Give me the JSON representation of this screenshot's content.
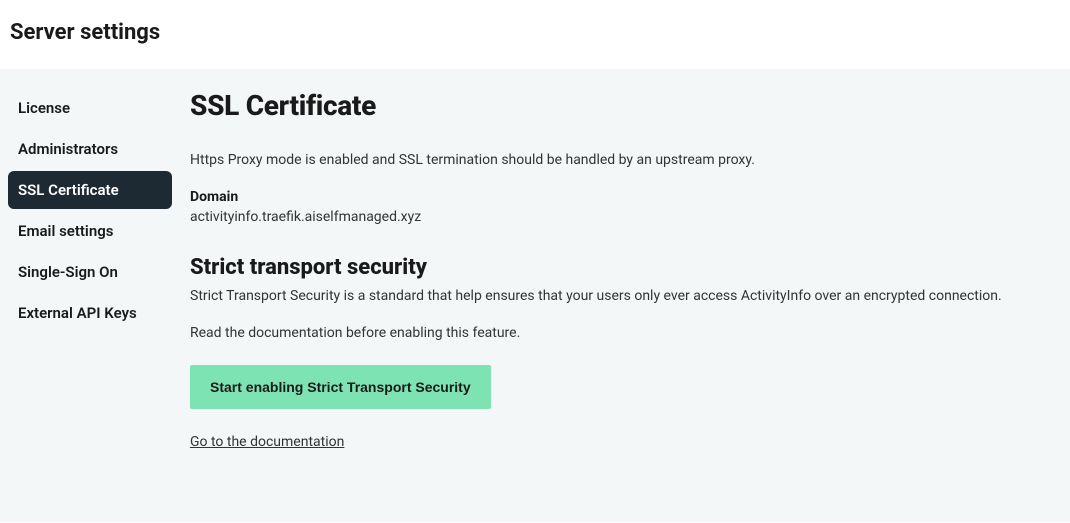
{
  "header": {
    "title": "Server settings"
  },
  "sidebar": {
    "items": [
      {
        "label": "License",
        "active": false
      },
      {
        "label": "Administrators",
        "active": false
      },
      {
        "label": "SSL Certificate",
        "active": true
      },
      {
        "label": "Email settings",
        "active": false
      },
      {
        "label": "Single-Sign On",
        "active": false
      },
      {
        "label": "External API Keys",
        "active": false
      }
    ]
  },
  "main": {
    "title": "SSL Certificate",
    "proxy_notice": "Https Proxy mode is enabled and SSL termination should be handled by an upstream proxy.",
    "domain_label": "Domain",
    "domain_value": "activityinfo.traefik.aiselfmanaged.xyz",
    "sts_title": "Strict transport security",
    "sts_description": "Strict Transport Security is a standard that help ensures that your users only ever access ActivityInfo over an encrypted connection.",
    "sts_read_doc": "Read the documentation before enabling this feature.",
    "sts_button": "Start enabling Strict Transport Security",
    "doc_link": "Go to the documentation"
  }
}
